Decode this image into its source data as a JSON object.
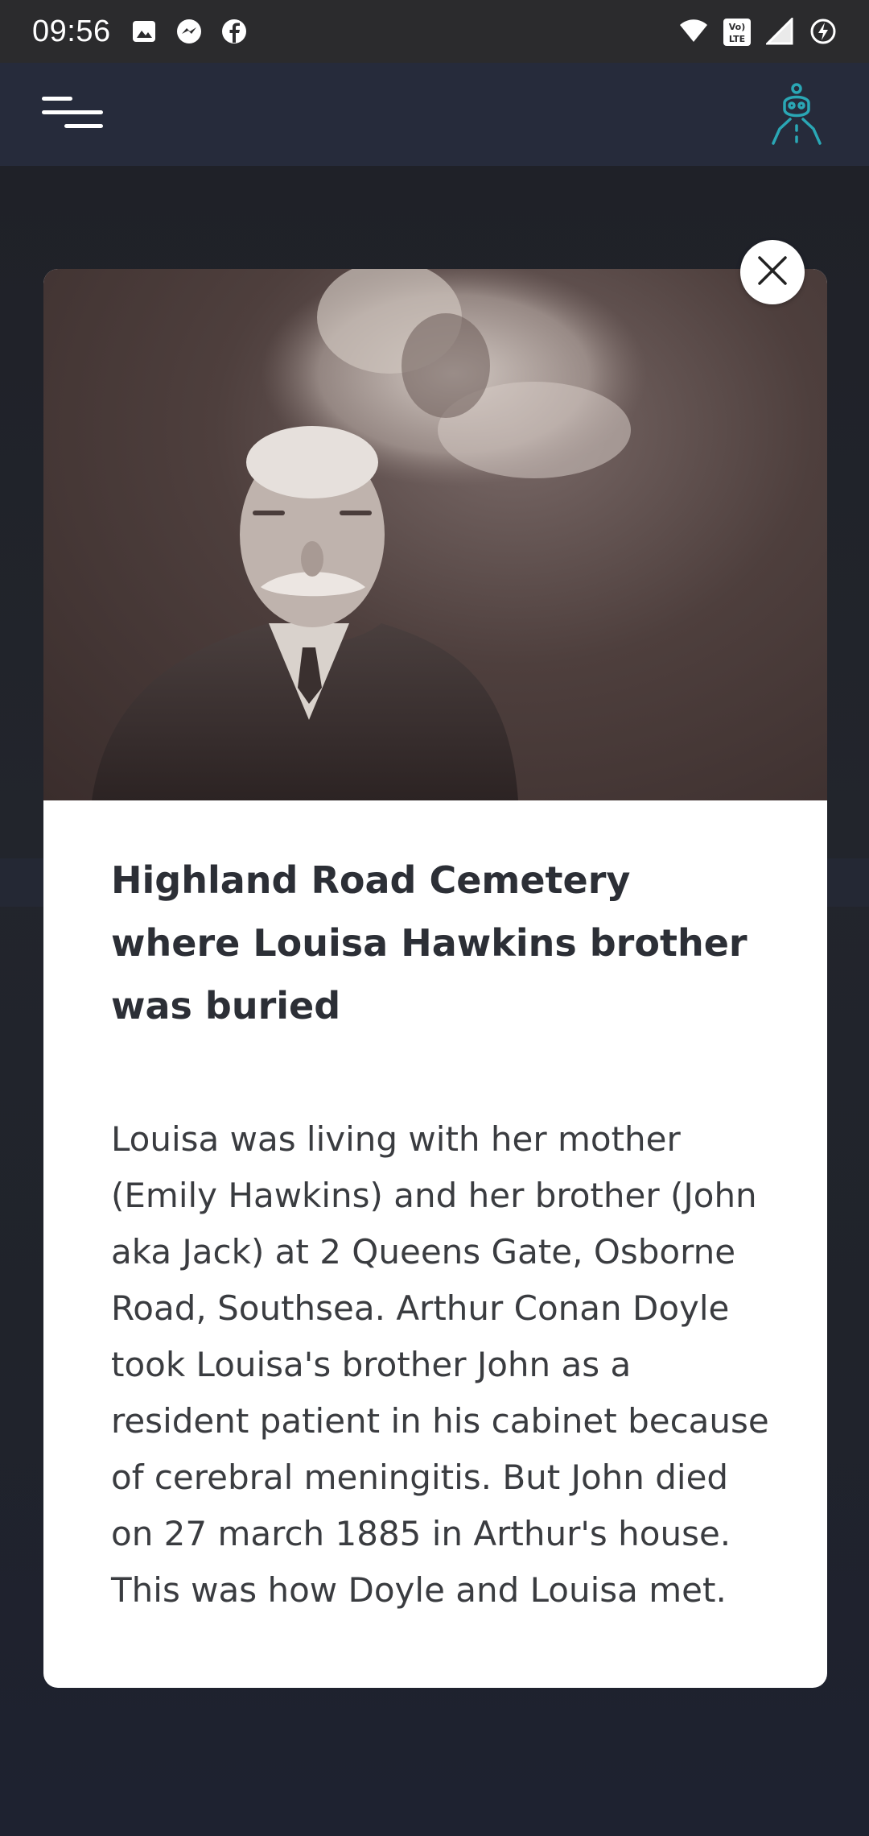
{
  "status_bar": {
    "time": "09:56",
    "left_icons": [
      "image-icon",
      "messenger-icon",
      "facebook-icon"
    ],
    "right_icons": [
      "wifi-icon",
      "volte-icon",
      "signal-icon",
      "battery-charging-icon"
    ]
  },
  "app_bar": {
    "menu_icon": "menu-icon",
    "avatar_icon": "ghost-hunter-avatar-icon",
    "accent": "#2aa7b5"
  },
  "modal": {
    "title": "Highland Road Cemetery where Louisa Hawkins brother was buried",
    "body": "Louisa was living with her mother (Emily Hawkins) and her brother (John aka Jack) at 2 Queens Gate, Osborne Road, Southsea. Arthur Conan Doyle took Louisa's brother John as a resident patient in his cabinet because of cerebral meningitis. But John died on 27 march 1885 in Arthur's house. This was how Doyle and Louisa met.",
    "close_icon": "close-icon"
  }
}
